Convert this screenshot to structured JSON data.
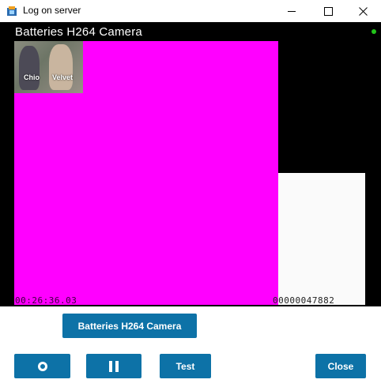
{
  "window": {
    "title": "Log on server",
    "icons": {
      "app": "app-icon",
      "minimize": "minimize-icon",
      "maximize": "maximize-icon",
      "close": "close-icon"
    }
  },
  "video": {
    "camera_title": "Batteries H264 Camera",
    "live_indicator_color": "#22c41a",
    "thumbnail_labels": [
      "Chio",
      "Velvet"
    ],
    "timestamp": "00:26:36.03",
    "frame_counter": "00000047882"
  },
  "buttons": {
    "camera_label": "Batteries H264 Camera",
    "record_icon": "record-icon",
    "pause_icon": "pause-icon",
    "test_label": "Test",
    "close_label": "Close"
  },
  "colors": {
    "accent": "#0d72a7",
    "video_bg": "#000000",
    "magenta_frame": "#ff00ff"
  }
}
